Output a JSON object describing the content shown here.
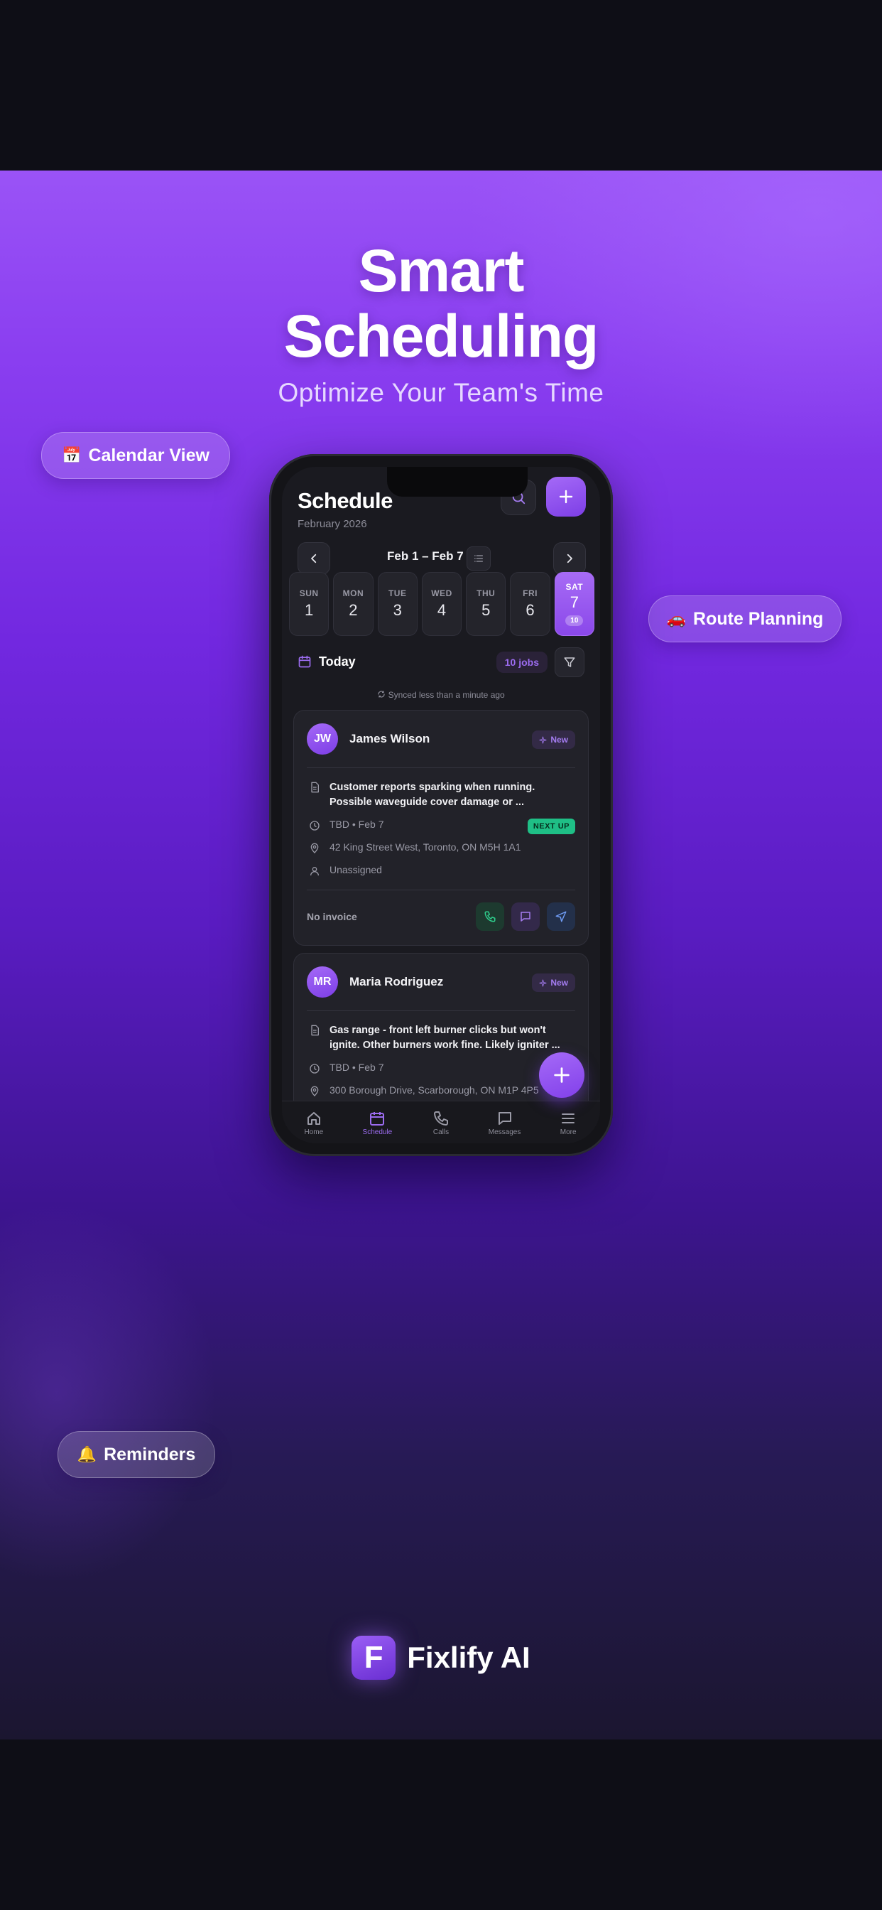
{
  "poster": {
    "headline_line1": "Smart",
    "headline_line2": "Scheduling",
    "subheadline": "Optimize Your Team's Time",
    "callouts": {
      "calendar_view": {
        "emoji": "📅",
        "label": "Calendar View"
      },
      "route_planning": {
        "emoji": "🚗",
        "label": "Route Planning"
      },
      "reminders": {
        "emoji": "🔔",
        "label": "Reminders"
      }
    },
    "brand": {
      "logo_letter": "F",
      "name": "Fixlify AI"
    }
  },
  "app": {
    "title": "Schedule",
    "month": "February 2026",
    "week_range": "Feb 1 – Feb 7",
    "days": [
      {
        "dow": "SUN",
        "num": "1"
      },
      {
        "dow": "MON",
        "num": "2"
      },
      {
        "dow": "TUE",
        "num": "3"
      },
      {
        "dow": "WED",
        "num": "4"
      },
      {
        "dow": "THU",
        "num": "5"
      },
      {
        "dow": "FRI",
        "num": "6"
      },
      {
        "dow": "SAT",
        "num": "7",
        "count": "10",
        "selected": true
      }
    ],
    "today_label": "Today",
    "jobs_count": "10 jobs",
    "synced_text": "Synced less than a minute ago",
    "jobs": [
      {
        "initials": "JW",
        "customer": "James Wilson",
        "status": "New",
        "description": "Customer reports sparking when running. Possible waveguide cover damage or ...",
        "time": "TBD • Feb 7",
        "badge": "NEXT UP",
        "address": "42 King Street West, Toronto, ON M5H 1A1",
        "assignee": "Unassigned",
        "invoice": "No invoice"
      },
      {
        "initials": "MR",
        "customer": "Maria Rodriguez",
        "status": "New",
        "description": "Gas range - front left burner clicks but won't ignite. Other burners work fine. Likely igniter ...",
        "time": "TBD • Feb 7",
        "address": "300 Borough Drive, Scarborough, ON M1P 4P5"
      }
    ],
    "tabs": [
      {
        "icon": "home-icon",
        "label": "Home"
      },
      {
        "icon": "calendar-icon",
        "label": "Schedule",
        "active": true
      },
      {
        "icon": "phone-icon",
        "label": "Calls"
      },
      {
        "icon": "message-icon",
        "label": "Messages"
      },
      {
        "icon": "menu-icon",
        "label": "More"
      }
    ]
  },
  "colors": {
    "accent": "#8b4cf0",
    "next_up": "#1fbf86",
    "screen_bg": "#1a1a20",
    "card_bg": "#222229"
  }
}
